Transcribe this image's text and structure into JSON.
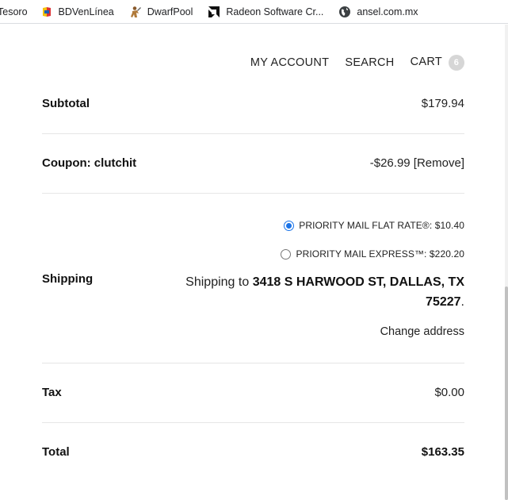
{
  "bookmarks": [
    {
      "label": "Tesoro",
      "icon": "bookmark-tesoro-icon"
    },
    {
      "label": "BDVenLínea",
      "icon": "bdv-icon"
    },
    {
      "label": "DwarfPool",
      "icon": "dwarfpool-icon"
    },
    {
      "label": "Radeon Software Cr...",
      "icon": "amd-radeon-icon"
    },
    {
      "label": "ansel.com.mx",
      "icon": "globe-icon"
    }
  ],
  "nav": {
    "my_account": "MY ACCOUNT",
    "search": "SEARCH",
    "cart": "CART",
    "cart_count": "6"
  },
  "summary": {
    "subtotal": {
      "label": "Subtotal",
      "value": "$179.94"
    },
    "coupon": {
      "label": "Coupon: clutchit",
      "amount": "-$26.99",
      "remove": "[Remove]"
    },
    "shipping": {
      "label": "Shipping",
      "options": [
        {
          "label": "PRIORITY MAIL FLAT RATE®: $10.40",
          "selected": true
        },
        {
          "label": "PRIORITY MAIL EXPRESS™: $220.20",
          "selected": false
        }
      ],
      "ship_to_prefix": "Shipping to ",
      "address": "3418 S HARWOOD ST, DALLAS, TX 75227",
      "ship_to_suffix": ".",
      "change_address": "Change address"
    },
    "tax": {
      "label": "Tax",
      "value": "$0.00"
    },
    "total": {
      "label": "Total",
      "value": "$163.35"
    }
  },
  "colors": {
    "radio_selected": "#1a73e8",
    "cart_badge": "#d6d6d6",
    "divider": "#e6e6e6"
  }
}
